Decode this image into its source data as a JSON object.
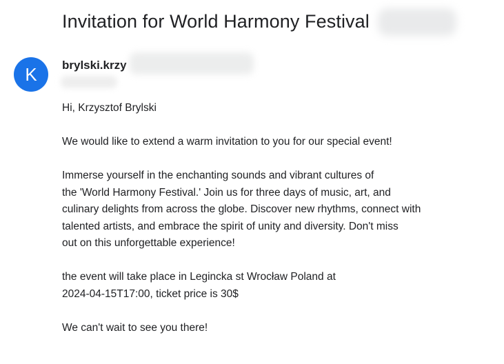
{
  "email": {
    "subject": "Invitation for World Harmony Festival",
    "sender": {
      "avatar_letter": "K",
      "name_visible": "brylski.krzy"
    },
    "greeting": "Hi, Krzysztof Brylski",
    "paragraph_1": "We would like to extend a warm invitation to you for our special event!",
    "paragraph_2_lines": [
      "Immerse yourself in the enchanting sounds and vibrant cultures of",
      "the 'World Harmony Festival.' Join us for three days of music, art, and",
      "culinary delights from across the globe. Discover new rhythms, connect with",
      "talented artists, and embrace the spirit of unity and diversity. Don't miss",
      "out on this unforgettable experience!"
    ],
    "paragraph_3_lines": [
      "the event will take place in Legincka st Wrocław Poland at",
      "2024-04-15T17:00, ticket price is 30$"
    ],
    "closing": "We can't wait to see you there!"
  },
  "colors": {
    "avatar_bg": "#1a73e8",
    "text": "#202124"
  }
}
